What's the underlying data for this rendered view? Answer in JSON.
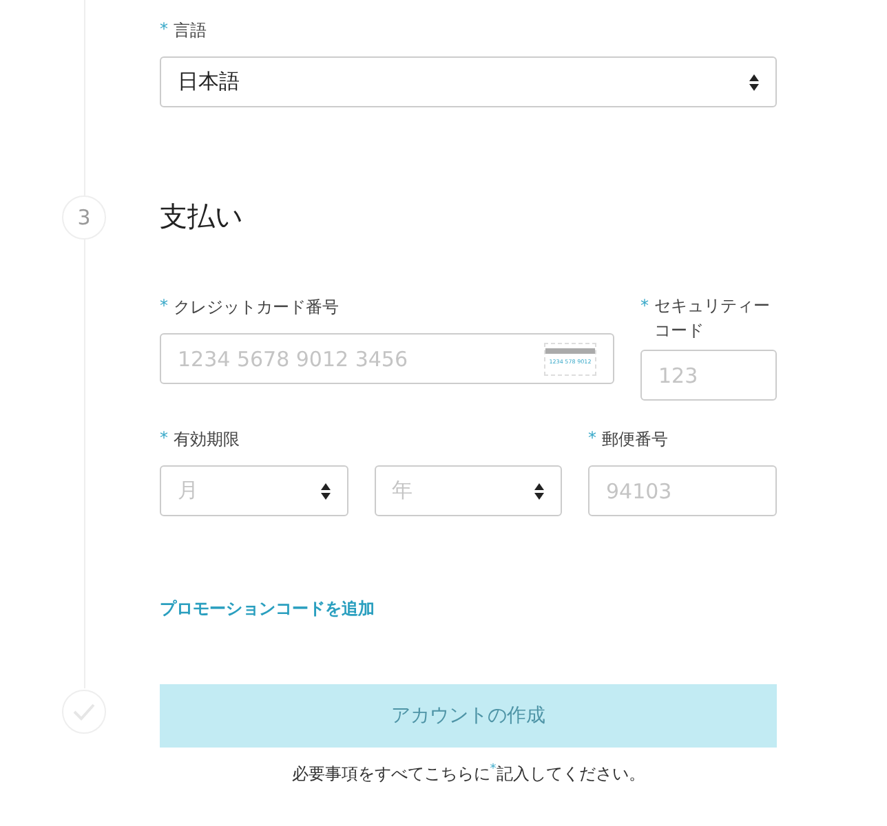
{
  "language": {
    "label": "言語",
    "required": true,
    "value": "日本語"
  },
  "payment": {
    "step": "3",
    "heading": "支払い"
  },
  "card_number": {
    "label": "クレジットカード番号",
    "required": true,
    "placeholder": "1234 5678 9012 3456",
    "card_icon_text": "1234 578 9012"
  },
  "security_code": {
    "label": "セキュリティーコード",
    "required": true,
    "placeholder": "123"
  },
  "expiry": {
    "label": "有効期限",
    "required": true,
    "month_placeholder": "月",
    "year_placeholder": "年"
  },
  "postal_code": {
    "label": "郵便番号",
    "required": true,
    "placeholder": "94103"
  },
  "promo_link": "プロモーションコードを追加",
  "submit": {
    "label": "アカウントの作成",
    "disabled": true
  },
  "footer_note": {
    "before": "必要事項をすべてこちらに",
    "mark": "*",
    "after": "記入してください。"
  }
}
